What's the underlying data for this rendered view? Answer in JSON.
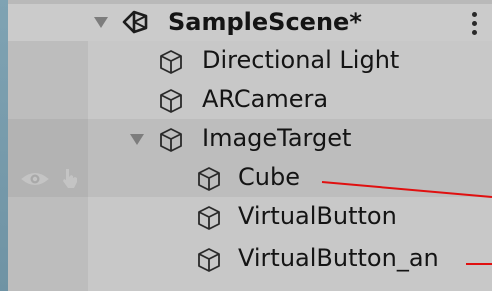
{
  "hierarchy": {
    "scene_name": "SampleScene*",
    "items": [
      {
        "label": "Directional Light",
        "icon": "cube-icon"
      },
      {
        "label": "ARCamera",
        "icon": "cube-icon"
      },
      {
        "label": "ImageTarget",
        "icon": "cube-icon",
        "expanded": true
      },
      {
        "label": "Cube",
        "icon": "cube-icon",
        "parent": "ImageTarget"
      },
      {
        "label": "VirtualButton",
        "icon": "cube-icon",
        "parent": "ImageTarget"
      },
      {
        "label": "VirtualButton_an",
        "icon": "cube-icon",
        "parent": "ImageTarget"
      }
    ]
  },
  "colors": {
    "panel_bg": "#c8c8c8",
    "gutter_bg": "#bdbdbd",
    "text": "#141414",
    "annotation": "#e01010"
  }
}
